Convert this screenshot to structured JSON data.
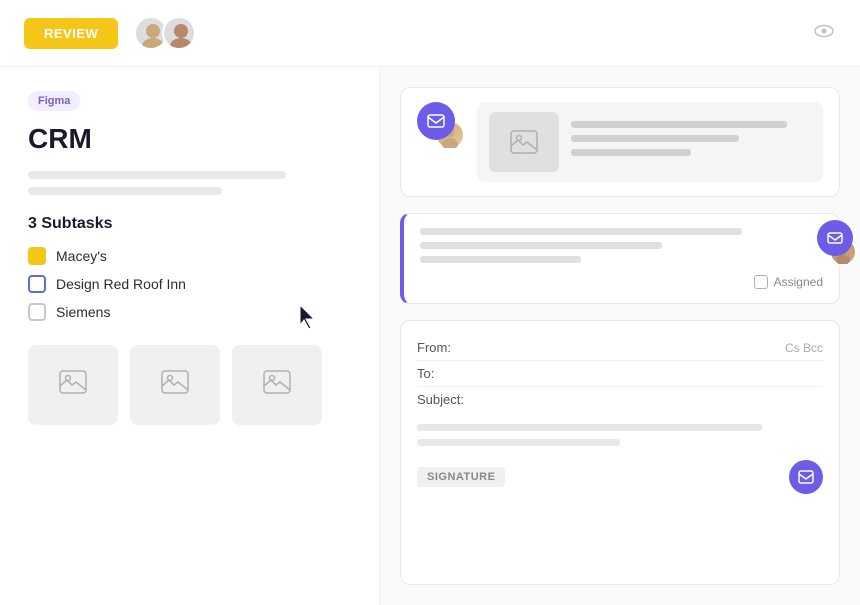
{
  "header": {
    "review_label": "REVIEW",
    "eye_icon": "👁"
  },
  "left_panel": {
    "tag": "Figma",
    "title": "CRM",
    "subtasks_heading": "3 Subtasks",
    "subtasks": [
      {
        "id": 1,
        "label": "Macey's",
        "dot_type": "yellow"
      },
      {
        "id": 2,
        "label": "Design Red Roof Inn",
        "dot_type": "blue"
      },
      {
        "id": 3,
        "label": "Siemens",
        "dot_type": "gray"
      }
    ],
    "thumbnails": [
      {
        "id": 1
      },
      {
        "id": 2
      },
      {
        "id": 3
      }
    ]
  },
  "right_panel": {
    "email_card_1": {
      "content_alt": "Email with image preview"
    },
    "email_card_2": {
      "assigned_label": "Assigned"
    },
    "compose": {
      "from_label": "From:",
      "to_label": "To:",
      "subject_label": "Subject:",
      "cc_label": "Cs Bcc",
      "signature_label": "SIGNATURE"
    }
  }
}
